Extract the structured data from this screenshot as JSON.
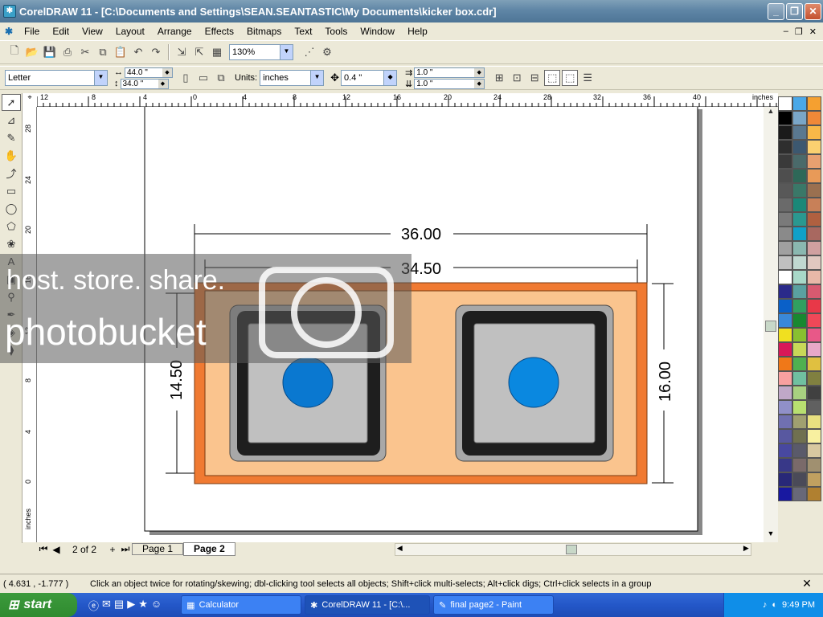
{
  "window": {
    "title": "CorelDRAW 11 - [C:\\Documents and Settings\\SEAN.SEANTASTIC\\My Documents\\kicker box.cdr]"
  },
  "menu": [
    "File",
    "Edit",
    "View",
    "Layout",
    "Arrange",
    "Effects",
    "Bitmaps",
    "Text",
    "Tools",
    "Window",
    "Help"
  ],
  "toolbar": {
    "zoom": "130%"
  },
  "propbar": {
    "paper": "Letter",
    "width": "44.0 \"",
    "height": "34.0 \"",
    "units_label": "Units:",
    "units": "inches",
    "nudge": "0.4 \"",
    "dup_x": "1.0 \"",
    "dup_y": "1.0 \""
  },
  "ruler": {
    "h_labels": [
      "12",
      "8",
      "4",
      "0",
      "4",
      "8",
      "12",
      "16",
      "20",
      "24",
      "28",
      "32",
      "36",
      "40"
    ],
    "h_unit": "inches",
    "v_labels": [
      "28",
      "24",
      "20",
      "16",
      "12",
      "8",
      "4",
      "0"
    ],
    "v_unit": "inches"
  },
  "drawing": {
    "dim_top": "36.00",
    "dim_inner": "34.50",
    "dim_left": "14.50",
    "dim_right": "16.00",
    "box_color": "#f07a32",
    "box_inner_color": "#fac48e",
    "port_color": "#0a78d0"
  },
  "pages": {
    "counter": "2 of 2",
    "tab1": "Page 1",
    "tab2": "Page 2"
  },
  "status": {
    "coords": "( 4.631 , -1.777 )",
    "hint": "Click an object twice for rotating/skewing; dbl-clicking tool selects all objects; Shift+click multi-selects; Alt+click digs; Ctrl+click selects in a group"
  },
  "taskbar": {
    "start": "start",
    "tasks": [
      "Calculator",
      "CorelDRAW 11 - [C:\\...",
      "final page2 - Paint"
    ],
    "clock": "9:49 PM"
  },
  "watermark": {
    "line1": "host. store. share.",
    "line2": "photobucket"
  },
  "palette_colors": [
    "#ffffff",
    "#4aa8e8",
    "#f5a030",
    "#000000",
    "#7aa6c8",
    "#f08838",
    "#1a1a1a",
    "#5a7890",
    "#f8b848",
    "#2e2e2e",
    "#3c5870",
    "#fad070",
    "#3a3a3a",
    "#4a6a6a",
    "#e8a070",
    "#4e4e4e",
    "#2e6858",
    "#e89a58",
    "#585858",
    "#3a7868",
    "#9a7050",
    "#6a6a6a",
    "#1a8878",
    "#c88058",
    "#7a7a7a",
    "#2a9890",
    "#b06040",
    "#8a8a8a",
    "#10a0c8",
    "#a86860",
    "#a0a0a0",
    "#8ab8b0",
    "#d0a0a0",
    "#c0c0c0",
    "#c0d8d0",
    "#e0c8c0",
    "#ffffff",
    "#a8d8c8",
    "#e8b8a8",
    "#2a2a8a",
    "#5aa0a0",
    "#d85a70",
    "#0a60c8",
    "#30a060",
    "#e83848",
    "#3a88d8",
    "#188830",
    "#f04858",
    "#f0e020",
    "#88c030",
    "#e85888",
    "#d81858",
    "#c8d858",
    "#e8a8c8",
    "#f07818",
    "#50b050",
    "#e0c040",
    "#f8a0a0",
    "#70c0a0",
    "#808040",
    "#c0a8c8",
    "#a8d080",
    "#404040",
    "#9090c8",
    "#b8e070",
    "#606060",
    "#7070b0",
    "#a0a070",
    "#e8e080",
    "#5858a0",
    "#707050",
    "#f8f0a0",
    "#4848a0",
    "#5a5a6a",
    "#d8c8a0",
    "#383888",
    "#7a6a6a",
    "#a09070",
    "#282878",
    "#4a4a58",
    "#c0a060",
    "#1818a0",
    "#686878",
    "#b08030"
  ]
}
